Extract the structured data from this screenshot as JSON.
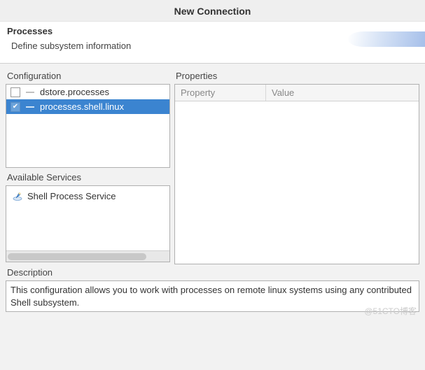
{
  "dialog": {
    "title": "New Connection"
  },
  "banner": {
    "heading": "Processes",
    "subtitle": "Define subsystem information"
  },
  "configuration": {
    "label": "Configuration",
    "items": [
      {
        "id": "dstore.processes",
        "checked": false,
        "selected": false
      },
      {
        "id": "processes.shell.linux",
        "checked": true,
        "selected": true
      }
    ]
  },
  "properties": {
    "label": "Properties",
    "columns": {
      "property": "Property",
      "value": "Value"
    },
    "rows": []
  },
  "available_services": {
    "label": "Available Services",
    "items": [
      {
        "name": "Shell Process Service"
      }
    ]
  },
  "description": {
    "label": "Description",
    "text": "This configuration allows you to work with processes on remote linux systems using any contributed Shell subsystem."
  },
  "watermark": "@51CTO博客"
}
